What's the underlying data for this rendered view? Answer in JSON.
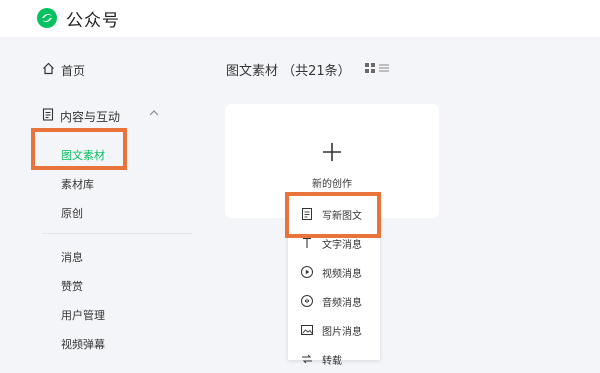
{
  "app": {
    "brand": "公众号",
    "brand_color": "#07c160",
    "highlight_color": "#e8743b"
  },
  "sidebar": {
    "home_label": "首页",
    "section_label": "内容与互动",
    "sub_items": [
      "图文素材",
      "素材库",
      "原创"
    ],
    "active_index": 0,
    "more_items": [
      "消息",
      "赞赏",
      "用户管理",
      "视频弹幕"
    ]
  },
  "main": {
    "title": "图文素材 （共21条）",
    "create_label": "新的创作",
    "dropdown": [
      {
        "label": "写新图文",
        "icon": "document-icon"
      },
      {
        "label": "文字消息",
        "icon": "text-icon"
      },
      {
        "label": "视频消息",
        "icon": "video-icon"
      },
      {
        "label": "音频消息",
        "icon": "audio-icon"
      },
      {
        "label": "图片消息",
        "icon": "image-icon"
      },
      {
        "label": "转载",
        "icon": "repost-icon"
      }
    ]
  }
}
